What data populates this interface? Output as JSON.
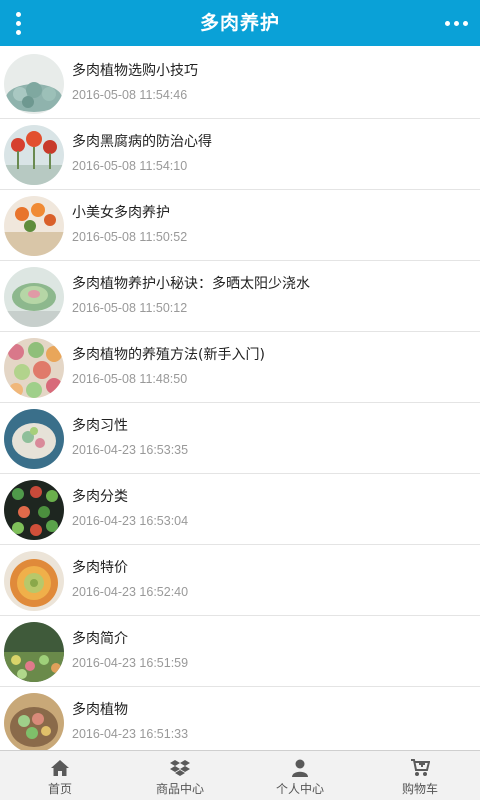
{
  "header": {
    "title": "多肉养护",
    "menu_icon": "vertical-dots-icon",
    "more_icon": "horizontal-dots-icon"
  },
  "colors": {
    "header_bg": "#0aa1d7",
    "date_text": "#999999"
  },
  "articles": [
    {
      "title": "多肉植物选购小技巧",
      "date": "2016-05-08 11:54:46"
    },
    {
      "title": "多肉黑腐病的防治心得",
      "date": "2016-05-08 11:54:10"
    },
    {
      "title": "小美女多肉养护",
      "date": "2016-05-08 11:50:52"
    },
    {
      "title": "多肉植物养护小秘诀：多晒太阳少浇水",
      "date": "2016-05-08 11:50:12"
    },
    {
      "title": "多肉植物的养殖方法(新手入门)",
      "date": "2016-05-08 11:48:50"
    },
    {
      "title": "多肉习性",
      "date": "2016-04-23 16:53:35"
    },
    {
      "title": "多肉分类",
      "date": "2016-04-23 16:53:04"
    },
    {
      "title": "多肉特价",
      "date": "2016-04-23 16:52:40"
    },
    {
      "title": "多肉简介",
      "date": "2016-04-23 16:51:59"
    },
    {
      "title": "多肉植物",
      "date": "2016-04-23 16:51:33"
    }
  ],
  "tabbar": [
    {
      "label": "首页",
      "icon": "home-icon"
    },
    {
      "label": "商品中心",
      "icon": "dropbox-icon"
    },
    {
      "label": "个人中心",
      "icon": "user-icon"
    },
    {
      "label": "购物车",
      "icon": "cart-icon"
    }
  ]
}
